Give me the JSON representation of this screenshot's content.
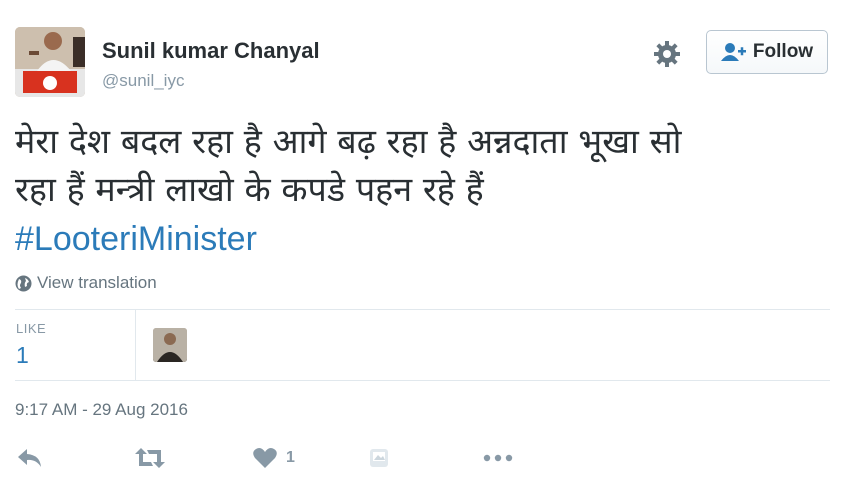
{
  "user": {
    "name": "Sunil kumar Chanyal",
    "handle": "@sunil_iyc"
  },
  "header": {
    "follow_label": "Follow"
  },
  "tweet": {
    "line1": "मेरा देश बदल रहा है आगे बढ़ रहा है अन्नदाता भूखा सो",
    "line2": "रहा हैं मन्त्री लाखो के कपडे पहन रहे हैं",
    "hashtag": "#LooteriMinister",
    "translate_label": "View translation"
  },
  "stats": {
    "like_label": "LIKE",
    "like_count": "1"
  },
  "timestamp": "9:17 AM - 29 Aug 2016",
  "actions": {
    "like_count": "1"
  },
  "colors": {
    "link": "#2b7bb9",
    "muted": "#8899a6",
    "text": "#292f33",
    "border": "#e1e8ed"
  },
  "icons": [
    "gear-icon",
    "follow-user-icon",
    "globe-icon",
    "reply-icon",
    "retweet-icon",
    "heart-icon",
    "moments-icon",
    "more-icon"
  ]
}
